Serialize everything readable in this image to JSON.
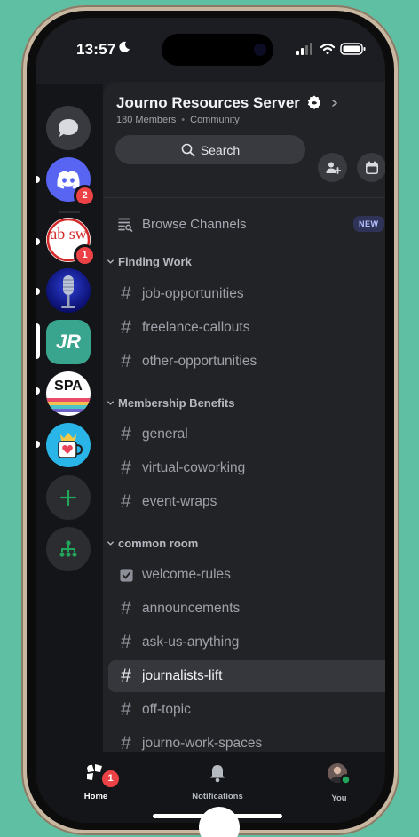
{
  "status_bar": {
    "time": "13:57"
  },
  "server": {
    "name": "Journo Resources Server",
    "members": "180 Members",
    "type": "Community",
    "search_label": "Search"
  },
  "rail": {
    "dm_icon": "chat-bubble-icon",
    "discord_badge": "2",
    "absw_label": "ab sw",
    "absw_badge": "1",
    "jr_label": "JR",
    "spa_label": "SPA"
  },
  "browse": {
    "label": "Browse Channels",
    "badge": "NEW"
  },
  "categories": [
    {
      "name": "Finding Work",
      "channels": [
        "job-opportunities",
        "freelance-callouts",
        "other-opportunities"
      ]
    },
    {
      "name": "Membership Benefits",
      "channels": [
        "general",
        "virtual-coworking",
        "event-wraps"
      ]
    },
    {
      "name": "common room",
      "channels": [
        "welcome-rules",
        "announcements",
        "ask-us-anything",
        "journalists-lift",
        "off-topic",
        "journo-work-spaces"
      ]
    }
  ],
  "active_channel": "journalists-lift",
  "tabs": {
    "home": "Home",
    "home_badge": "1",
    "notifications": "Notifications",
    "you": "You"
  },
  "colors": {
    "accent": "#5865f2",
    "badge": "#ed4245",
    "jr_tile": "#3aa58f",
    "online": "#23a55a"
  }
}
